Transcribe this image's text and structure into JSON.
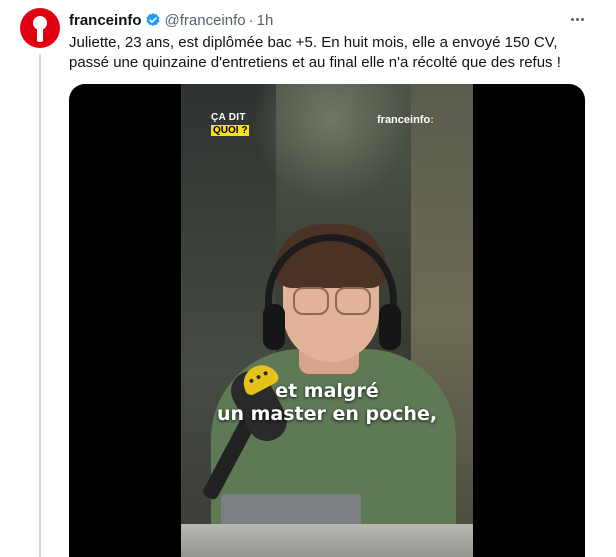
{
  "tweet": {
    "display_name": "franceinfo",
    "handle": "@franceinfo",
    "separator": "·",
    "time": "1h",
    "verified": true,
    "text": "Juliette, 23 ans, est diplômée bac +5. En huit mois, elle a envoyé 150 CV, passé une quinzaine d'entretiens et au final elle n'a récolté que des refus !",
    "more_icon": "more-horizontal-icon"
  },
  "video": {
    "brand_left_line1": "ÇA DIT",
    "brand_left_line2": "QUOI ?",
    "brand_right": "franceinfo",
    "caption_line1": "et malgré",
    "caption_line2": "un master en poche,"
  },
  "colors": {
    "avatar_red": "#e1000f",
    "verified_blue": "#1d9bf0",
    "meta_gray": "#536471",
    "brand_yellow": "#f5e11a"
  }
}
